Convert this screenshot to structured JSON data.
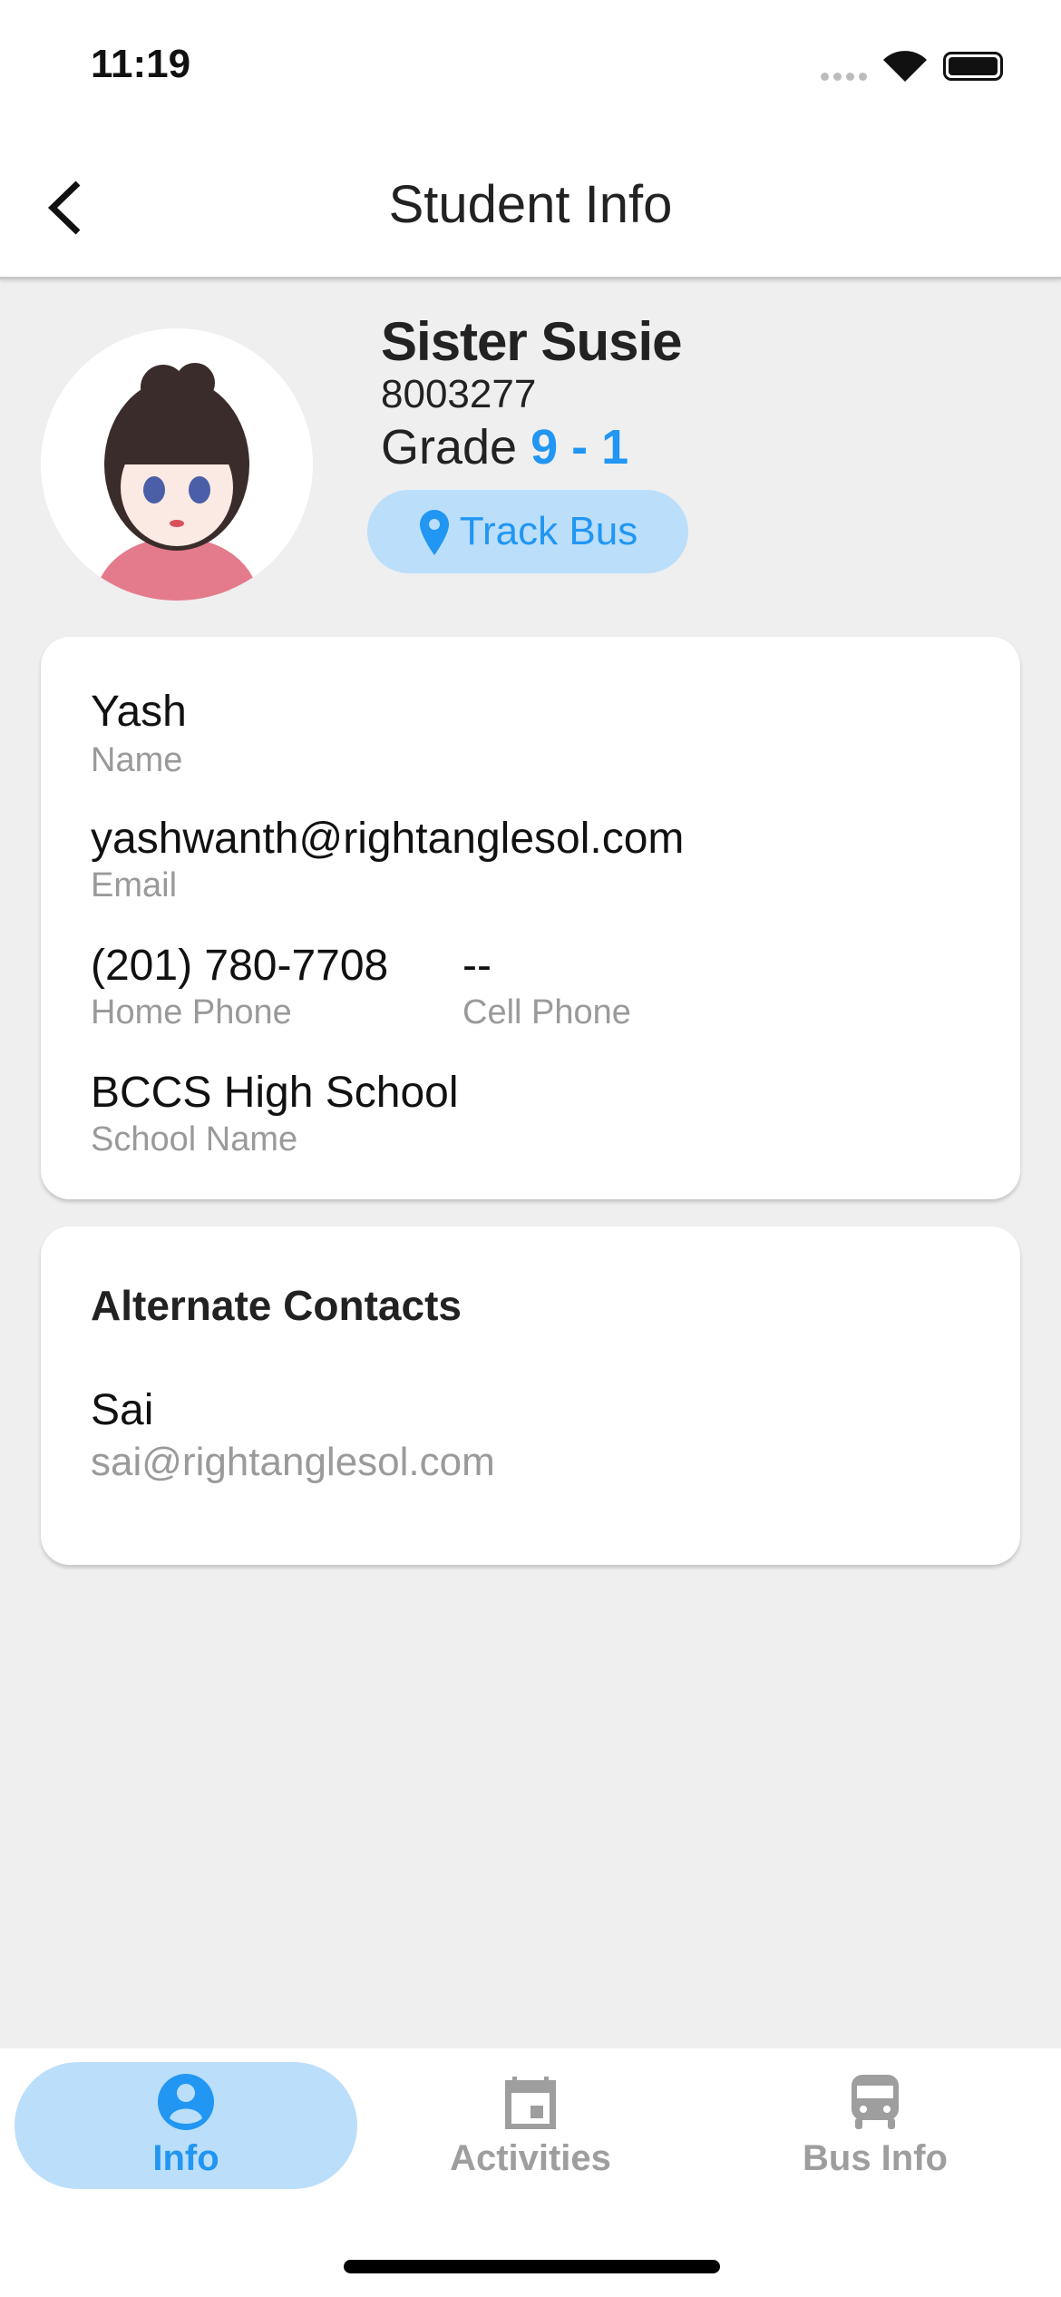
{
  "status_bar": {
    "time": "11:19"
  },
  "header": {
    "title": "Student Info",
    "back_icon": "chevron-left-icon"
  },
  "student": {
    "name": "Sister Susie",
    "id": "8003277",
    "grade_label": "Grade",
    "grade_value": "9 - 1",
    "track_bus_label": "Track Bus"
  },
  "info_card": {
    "name_value": "Yash",
    "name_label": "Name",
    "email_value": "yashwanth@rightanglesol.com",
    "email_label": "Email",
    "home_phone_value": "(201) 780-7708",
    "home_phone_label": "Home Phone",
    "cell_phone_value": "--",
    "cell_phone_label": "Cell Phone",
    "school_value": "BCCS High School",
    "school_label": "School Name"
  },
  "alternate_contacts": {
    "title": "Alternate Contacts",
    "contacts": [
      {
        "name": "Sai",
        "email": "sai@rightanglesol.com"
      }
    ]
  },
  "bottom_nav": {
    "tabs": [
      {
        "label": "Info",
        "icon": "account-circle-icon",
        "active": true
      },
      {
        "label": "Activities",
        "icon": "calendar-icon"
      },
      {
        "label": "Bus Info",
        "icon": "bus-icon"
      }
    ]
  },
  "colors": {
    "accent": "#2196f3",
    "accent_light": "#bbdefb",
    "background": "#efefef"
  }
}
